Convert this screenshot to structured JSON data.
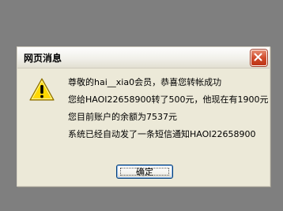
{
  "dialog": {
    "title": "网页消息",
    "close_icon": "close-icon",
    "warning_icon": "warning-icon",
    "messages": [
      "尊敬的hai__xia0会员，恭喜您转帐成功",
      "您给HAOI22658900转了500元，他现在有1900元",
      "您目前账户的余额为7537元",
      "系统已经自动发了一条短信通知HAOI22658900"
    ],
    "ok_label": "确定"
  },
  "colors": {
    "desktop": "#7f7f7f",
    "dialog_face": "#ece9d8",
    "close_button": "#d14c2c",
    "warning": "#ffd800"
  }
}
